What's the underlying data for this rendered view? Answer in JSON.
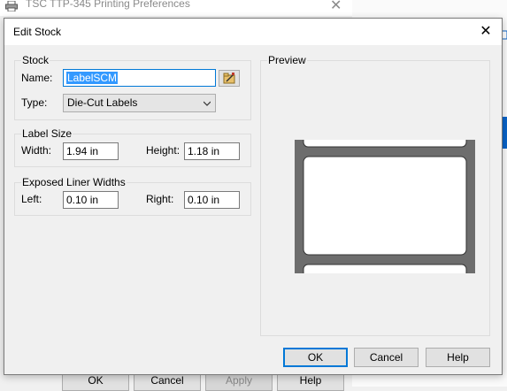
{
  "background_window": {
    "title": "TSC TTP-345 Printing Preferences",
    "close_glyph": "✕",
    "right_app_title_fragment": "...",
    "buttons": {
      "ok": "OK",
      "cancel": "Cancel",
      "apply": "Apply",
      "help": "Help"
    }
  },
  "dialog": {
    "title": "Edit Stock",
    "close_glyph": "✕",
    "stock": {
      "group_label": "Stock",
      "name_label": "Name:",
      "name_value": "LabelSCM",
      "type_label": "Type:",
      "type_value": "Die-Cut Labels",
      "browse_icon": "folder-edit-icon"
    },
    "label_size": {
      "group_label": "Label Size",
      "width_label": "Width:",
      "width_value": "1.94 in",
      "height_label": "Height:",
      "height_value": "1.18 in"
    },
    "liner": {
      "group_label": "Exposed Liner Widths",
      "left_label": "Left:",
      "left_value": "0.10 in",
      "right_label": "Right:",
      "right_value": "0.10 in"
    },
    "preview": {
      "label": "Preview",
      "liner_color": "#6d6d6d",
      "label_color": "#ffffff"
    },
    "buttons": {
      "ok": "OK",
      "cancel": "Cancel",
      "help": "Help"
    },
    "colors": {
      "accent": "#0078d7",
      "selection": "#3399ff"
    }
  }
}
